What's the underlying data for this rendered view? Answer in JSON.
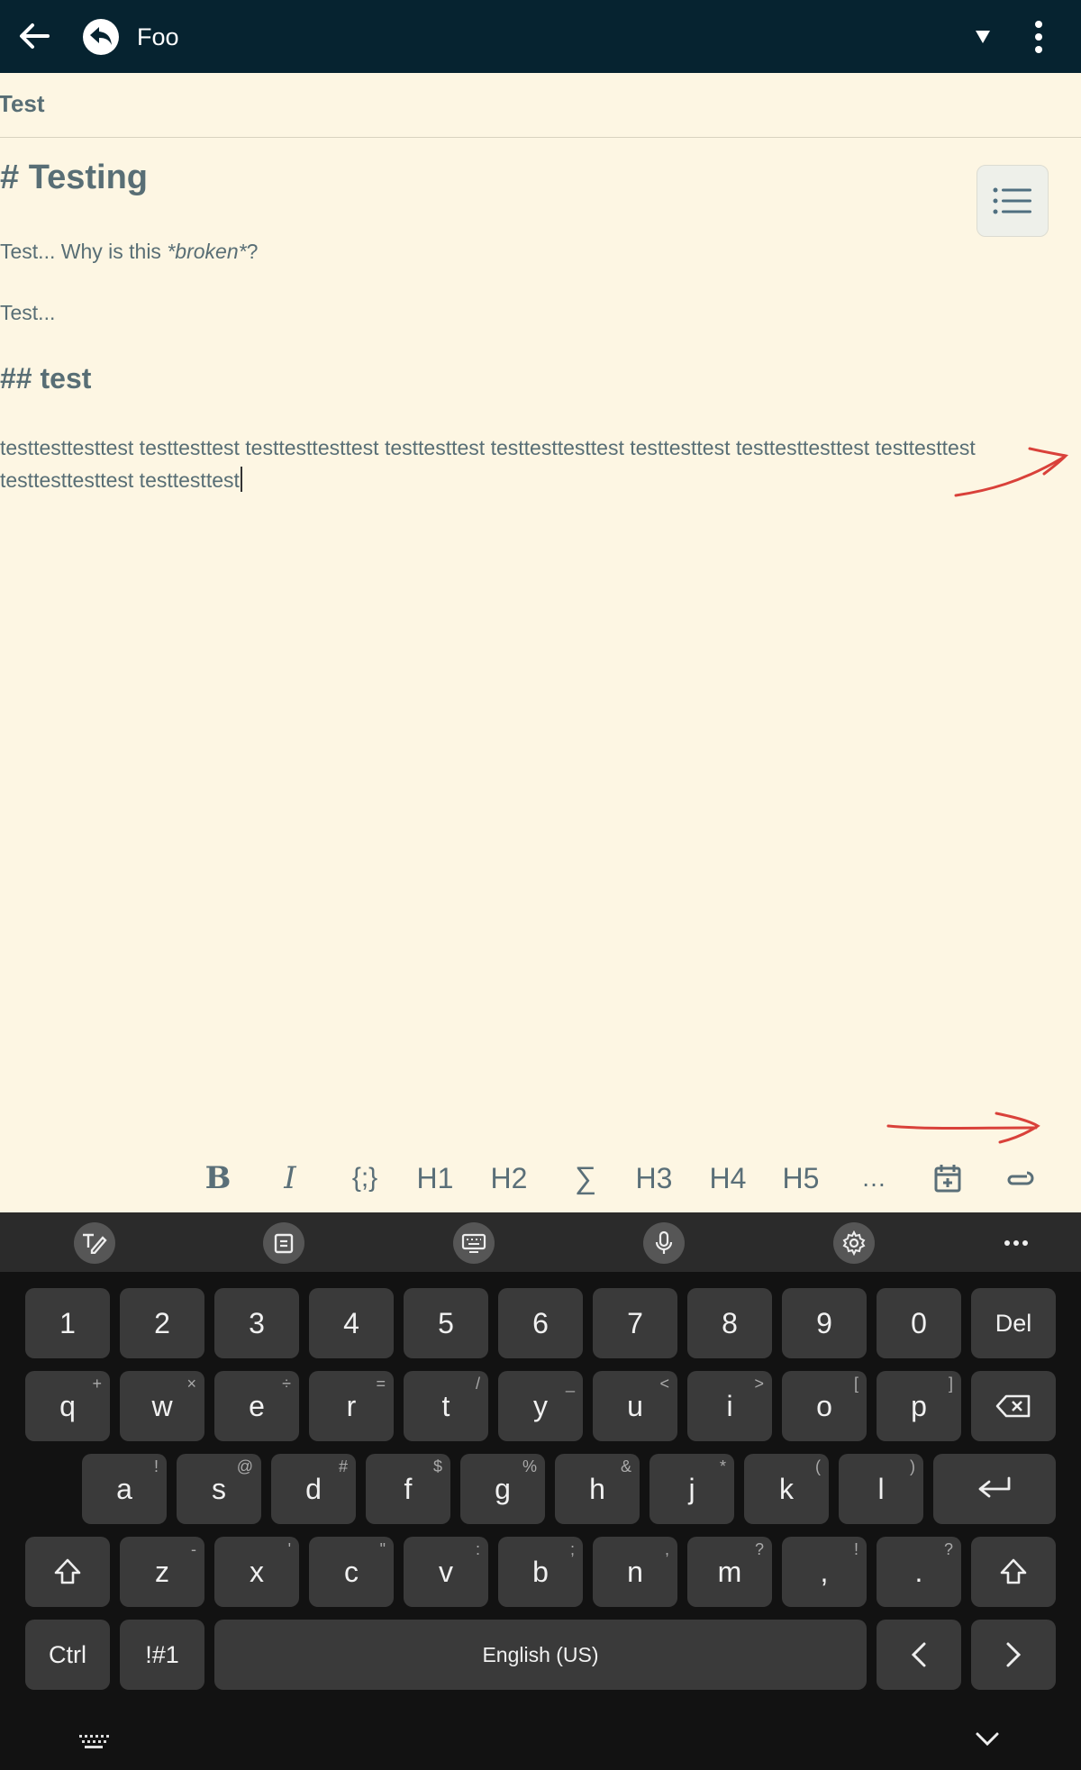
{
  "appbar": {
    "title": "Foo",
    "background": "#062330"
  },
  "note": {
    "title": "Test"
  },
  "editor": {
    "heading1": "# Testing",
    "para1_prefix": "Test... Why is this ",
    "para1_italic": "*broken*",
    "para1_suffix": "?",
    "para2": "Test...",
    "heading2": "## test",
    "long_line1": "testtesttesttest testtesttest testtesttesttest testtesttest testtesttesttest testtesttest testtesttesttest testtesttest",
    "long_line2": "testtesttesttest testtesttest",
    "text_color": "#586e75",
    "background": "#fdf6e3"
  },
  "format_toolbar": {
    "items": [
      {
        "name": "bold",
        "label": "B"
      },
      {
        "name": "italic",
        "label": "I"
      },
      {
        "name": "code",
        "label": "{;}"
      },
      {
        "name": "h1",
        "label": "H1"
      },
      {
        "name": "h2",
        "label": "H2"
      },
      {
        "name": "sum",
        "label": "∑"
      },
      {
        "name": "h3",
        "label": "H3"
      },
      {
        "name": "h4",
        "label": "H4"
      },
      {
        "name": "h5",
        "label": "H5"
      },
      {
        "name": "more",
        "label": "…"
      }
    ],
    "icons": [
      "calendar-add-icon",
      "paperclip-icon"
    ]
  },
  "keyboard": {
    "toolbar_icons": [
      "handwriting-icon",
      "clipboard-icon",
      "keyboard-icon",
      "microphone-icon",
      "settings-icon",
      "more-icon"
    ],
    "row_numbers": [
      "1",
      "2",
      "3",
      "4",
      "5",
      "6",
      "7",
      "8",
      "9",
      "0"
    ],
    "del_label": "Del",
    "row_q": [
      {
        "k": "q",
        "s": "+"
      },
      {
        "k": "w",
        "s": "×"
      },
      {
        "k": "e",
        "s": "÷"
      },
      {
        "k": "r",
        "s": "="
      },
      {
        "k": "t",
        "s": "/"
      },
      {
        "k": "y",
        "s": "_"
      },
      {
        "k": "u",
        "s": "<"
      },
      {
        "k": "i",
        "s": ">"
      },
      {
        "k": "o",
        "s": "["
      },
      {
        "k": "p",
        "s": "]"
      }
    ],
    "row_a": [
      {
        "k": "a",
        "s": "!"
      },
      {
        "k": "s",
        "s": "@"
      },
      {
        "k": "d",
        "s": "#"
      },
      {
        "k": "f",
        "s": "$"
      },
      {
        "k": "g",
        "s": "%"
      },
      {
        "k": "h",
        "s": "&"
      },
      {
        "k": "j",
        "s": "*"
      },
      {
        "k": "k",
        "s": "("
      },
      {
        "k": "l",
        "s": ")"
      }
    ],
    "row_z": [
      {
        "k": "z",
        "s": "-"
      },
      {
        "k": "x",
        "s": "'"
      },
      {
        "k": "c",
        "s": "\""
      },
      {
        "k": "v",
        "s": ":"
      },
      {
        "k": "b",
        "s": ";"
      },
      {
        "k": "n",
        "s": ","
      },
      {
        "k": "m",
        "s": "?"
      },
      {
        "k": ",",
        "s": "!"
      },
      {
        "k": ".",
        "s": "?"
      }
    ],
    "ctrl_label": "Ctrl",
    "sym_label": "!#1",
    "space_label": "English (US)"
  }
}
